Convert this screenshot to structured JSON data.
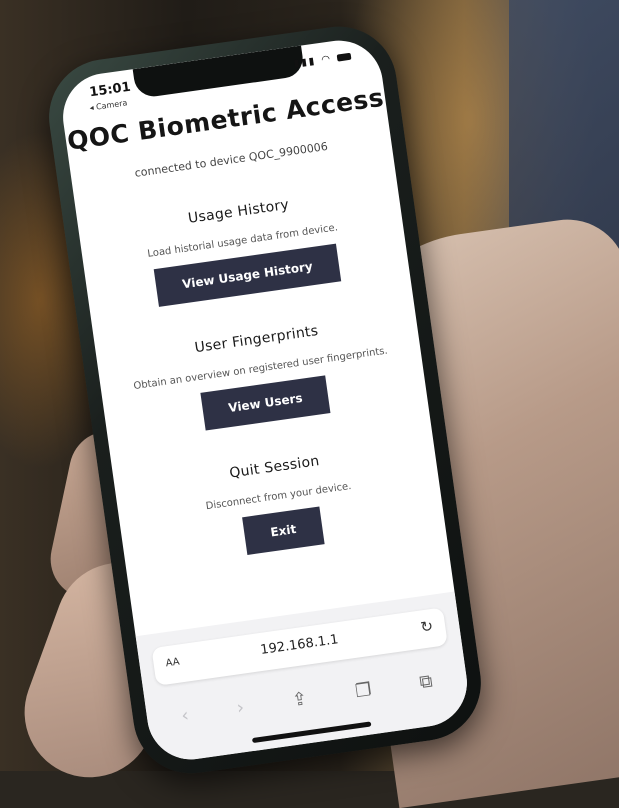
{
  "status": {
    "time": "15:01",
    "back_label": "◂ Camera"
  },
  "app": {
    "title": "QOC Biometric Access",
    "connection": "connected to device QOC_9900006"
  },
  "sections": [
    {
      "title": "Usage History",
      "description": "Load historial usage data from device.",
      "button": "View Usage History"
    },
    {
      "title": "User Fingerprints",
      "description": "Obtain an overview on registered user fingerprints.",
      "button": "View Users"
    },
    {
      "title": "Quit Session",
      "description": "Disconnect from your device.",
      "button": "Exit"
    }
  ],
  "browser": {
    "text_size_label": "AA",
    "url": "192.168.1.1"
  },
  "icons": {
    "reload": "reload-icon",
    "back": "chevron-left-icon",
    "forward": "chevron-right-icon",
    "share": "share-icon",
    "bookmarks": "book-icon",
    "tabs": "tabs-icon"
  },
  "colors": {
    "button_bg": "#2e3145",
    "button_text": "#ffffff"
  }
}
